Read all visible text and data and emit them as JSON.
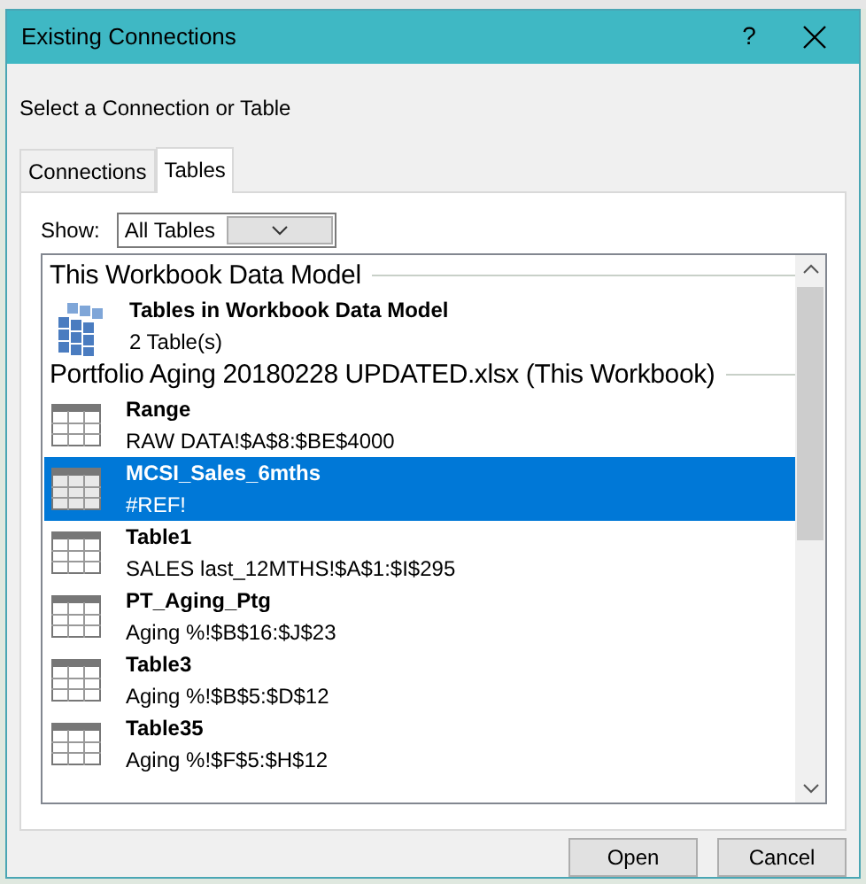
{
  "window": {
    "title": "Existing Connections",
    "help": "?"
  },
  "prompt": "Select a Connection or Table",
  "tabs": [
    {
      "label": "Connections",
      "selected": false
    },
    {
      "label": "Tables",
      "selected": true
    }
  ],
  "show": {
    "label": "Show:",
    "value": "All Tables"
  },
  "sections": [
    {
      "title": "This Workbook Data Model",
      "items": [
        {
          "kind": "cube",
          "name": "Tables in Workbook Data Model",
          "detail": "2 Table(s)",
          "selected": false
        }
      ]
    },
    {
      "title": "Portfolio Aging 20180228 UPDATED.xlsx (This Workbook)",
      "items": [
        {
          "kind": "table",
          "name": "Range",
          "detail": "RAW DATA!$A$8:$BE$4000",
          "selected": false
        },
        {
          "kind": "table",
          "name": "MCSI_Sales_6mths",
          "detail": "#REF!",
          "selected": true
        },
        {
          "kind": "table",
          "name": "Table1",
          "detail": "SALES last_12MTHS!$A$1:$I$295",
          "selected": false
        },
        {
          "kind": "table",
          "name": "PT_Aging_Ptg",
          "detail": "Aging %!$B$16:$J$23",
          "selected": false
        },
        {
          "kind": "table",
          "name": "Table3",
          "detail": "Aging %!$B$5:$D$12",
          "selected": false
        },
        {
          "kind": "table",
          "name": "Table35",
          "detail": "Aging %!$F$5:$H$12",
          "selected": false
        }
      ]
    }
  ],
  "buttons": [
    "Open",
    "Cancel"
  ]
}
